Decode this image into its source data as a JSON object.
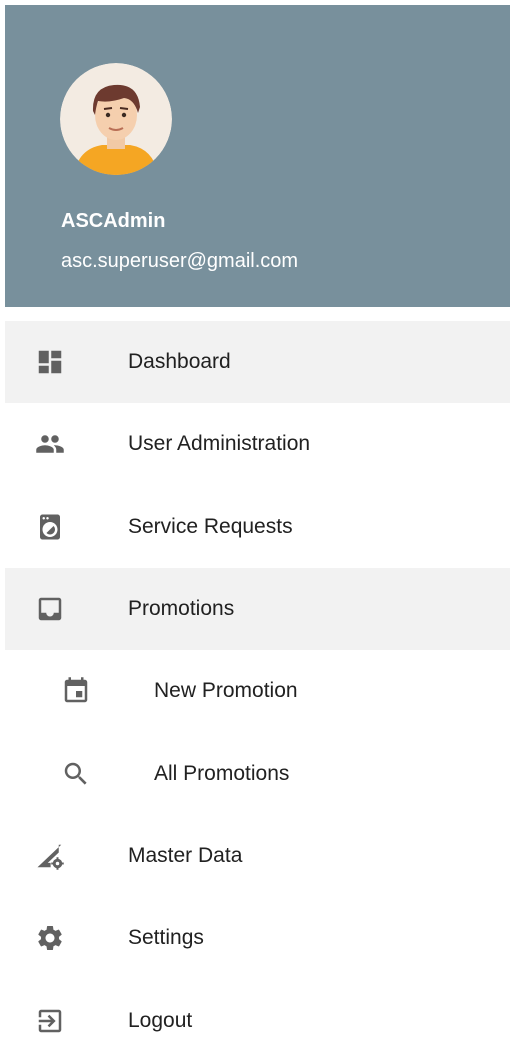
{
  "profile": {
    "name": "ASCAdmin",
    "email": "asc.superuser@gmail.com",
    "avatar_icon": "user-avatar"
  },
  "colors": {
    "header_bg": "#78909c",
    "active_bg": "#f2f2f2",
    "icon": "#616161"
  },
  "menu": {
    "items": [
      {
        "label": "Dashboard",
        "icon": "dashboard-icon",
        "active": true
      },
      {
        "label": "User Administration",
        "icon": "people-icon",
        "active": false
      },
      {
        "label": "Service Requests",
        "icon": "washing-machine-icon",
        "active": false
      },
      {
        "label": "Promotions",
        "icon": "inbox-icon",
        "active": true
      },
      {
        "label": "New Promotion",
        "icon": "calendar-icon",
        "active": false,
        "sub": true
      },
      {
        "label": "All Promotions",
        "icon": "search-icon",
        "active": false,
        "sub": true
      },
      {
        "label": "Master Data",
        "icon": "network-settings-icon",
        "active": false
      },
      {
        "label": "Settings",
        "icon": "gear-icon",
        "active": false
      },
      {
        "label": "Logout",
        "icon": "exit-icon",
        "active": false
      }
    ]
  }
}
